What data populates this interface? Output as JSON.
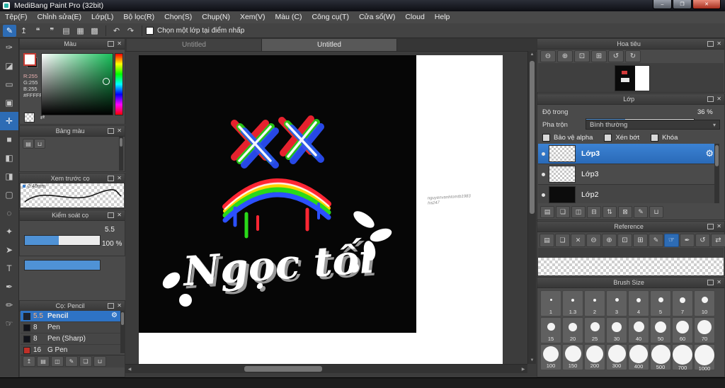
{
  "colors": {
    "accent": "#2e73c5",
    "selection_blue": "#2d6cb5",
    "close_red": "#a72f1f",
    "canvas_black": "#060606"
  },
  "icons": {
    "close": "✕",
    "gear": "⚙",
    "chevron": "▾",
    "undo": "↶",
    "redo": "↷",
    "up": "▲",
    "down": "▼",
    "left": "◀",
    "right": "▶",
    "swap": "⇄"
  },
  "window": {
    "title": "MediBang Paint Pro (32bit)",
    "min_glyph": "–",
    "max_glyph": "❐",
    "close_glyph": "✕"
  },
  "menu": {
    "items": [
      "Tệp(F)",
      "Chỉnh sửa(E)",
      "Lớp(L)",
      "Bộ lọc(R)",
      "Chọn(S)",
      "Chụp(N)",
      "Xem(V)",
      "Màu (C)",
      "Công cụ(T)",
      "Cửa sổ(W)",
      "Cloud",
      "Help"
    ]
  },
  "toolbar": {
    "snap_checkbox_label": "Chọn một lớp tại điểm nhấp",
    "icons": [
      {
        "name": "brush-mode",
        "glyph": "✎"
      },
      {
        "name": "upload",
        "glyph": "↥"
      },
      {
        "name": "comment",
        "glyph": "❝"
      },
      {
        "name": "chat",
        "glyph": "❞"
      },
      {
        "name": "page",
        "glyph": "▤"
      },
      {
        "name": "grid",
        "glyph": "▦"
      },
      {
        "name": "table",
        "glyph": "▩"
      }
    ]
  },
  "tools": [
    {
      "name": "brush",
      "glyph": "✑"
    },
    {
      "name": "eraser",
      "glyph": "◪"
    },
    {
      "name": "marquee",
      "glyph": "▭"
    },
    {
      "name": "stamp",
      "glyph": "▣"
    },
    {
      "name": "move",
      "glyph": "✛"
    },
    {
      "name": "fill",
      "glyph": "■"
    },
    {
      "name": "bucket",
      "glyph": "◧"
    },
    {
      "name": "gradient",
      "glyph": "◨"
    },
    {
      "name": "select",
      "glyph": "▢"
    },
    {
      "name": "lasso",
      "glyph": "◌"
    },
    {
      "name": "wand",
      "glyph": "✦"
    },
    {
      "name": "operation",
      "glyph": "➤"
    },
    {
      "name": "text",
      "glyph": "T"
    },
    {
      "name": "eyedropper",
      "glyph": "✒"
    },
    {
      "name": "pencil",
      "glyph": "✏"
    },
    {
      "name": "hand",
      "glyph": "☞"
    }
  ],
  "color_panel": {
    "title": "Màu",
    "r": "R:255",
    "g": "G:255",
    "b": "B:255",
    "hex": "#FFFFFF"
  },
  "palette_panel": {
    "title": "Bảng màu",
    "add_glyph": "▤",
    "trash_glyph": "⊔"
  },
  "brush_preview_panel": {
    "title": "Xem trước cọ",
    "size_label": "0.40mm"
  },
  "brush_control_panel": {
    "title": "Kiểm soát cọ",
    "size_value": "5.5",
    "opacity_value": "100 %"
  },
  "brush_list_panel": {
    "title": "Cọ: Pencil",
    "brushes": [
      {
        "size": "5.5",
        "name": "Pencil"
      },
      {
        "size": "8",
        "name": "Pen"
      },
      {
        "size": "8",
        "name": "Pen (Sharp)"
      },
      {
        "size": "16",
        "name": "G Pen"
      }
    ],
    "footer_icons": [
      {
        "name": "upload-brush",
        "glyph": "↥"
      },
      {
        "name": "add-brush",
        "glyph": "▤"
      },
      {
        "name": "duplicate-brush",
        "glyph": "◫"
      },
      {
        "name": "edit-brush",
        "glyph": "✎"
      },
      {
        "name": "brush-folder",
        "glyph": "❏"
      },
      {
        "name": "delete-brush",
        "glyph": "⊔"
      }
    ]
  },
  "canvas": {
    "tabs": [
      "Untitled",
      "Untitled"
    ],
    "artwork_text": "Ngọc tối",
    "watermark_line1": "nguyenvanhtomtb1983",
    "watermark_line2": "ha247"
  },
  "navigator_panel": {
    "title": "Hoa tiêu",
    "icons": [
      {
        "name": "zoom-out",
        "glyph": "⊖"
      },
      {
        "name": "zoom-in",
        "glyph": "⊕"
      },
      {
        "name": "fit-screen",
        "glyph": "⊡"
      },
      {
        "name": "actual-size",
        "glyph": "⊞"
      },
      {
        "name": "rotate-left",
        "glyph": "↺"
      },
      {
        "name": "rotate-right",
        "glyph": "↻"
      }
    ]
  },
  "layers_panel": {
    "title": "Lớp",
    "opacity_label": "Độ trong",
    "opacity_value": "36 %",
    "blend_label": "Pha trộn",
    "blend_value": "Bình thường",
    "checkboxes": [
      "Bảo vệ alpha",
      "Xén bớt",
      "Khóa"
    ],
    "layers": [
      {
        "name": "Lớp3"
      },
      {
        "name": "Lớp3"
      },
      {
        "name": "Lớp2"
      }
    ],
    "footer_icons": [
      {
        "name": "add-layer",
        "glyph": "▤"
      },
      {
        "name": "add-folder",
        "glyph": "❏"
      },
      {
        "name": "duplicate-layer",
        "glyph": "◫"
      },
      {
        "name": "merge-layer",
        "glyph": "⊟"
      },
      {
        "name": "transfer-layer",
        "glyph": "⇅"
      },
      {
        "name": "clear-layer",
        "glyph": "⊠"
      },
      {
        "name": "layer-settings",
        "glyph": "✎"
      },
      {
        "name": "delete-layer",
        "glyph": "⊔"
      }
    ]
  },
  "reference_panel": {
    "title": "Reference",
    "icons": [
      {
        "name": "open-image",
        "glyph": "▤"
      },
      {
        "name": "folder",
        "glyph": "❏"
      },
      {
        "name": "close-image",
        "glyph": "✕"
      },
      {
        "name": "zoom-out",
        "glyph": "⊖"
      },
      {
        "name": "zoom-in",
        "glyph": "⊕"
      },
      {
        "name": "fit-screen",
        "glyph": "⊡"
      },
      {
        "name": "actual-size",
        "glyph": "⊞"
      },
      {
        "name": "pencil",
        "glyph": "✎"
      },
      {
        "name": "hand",
        "glyph": "☞"
      },
      {
        "name": "eyedropper",
        "glyph": "✒"
      },
      {
        "name": "rotate",
        "glyph": "↺"
      },
      {
        "name": "flip",
        "glyph": "⇄"
      }
    ]
  },
  "brush_size_panel": {
    "title": "Brush Size",
    "sizes": [
      "1",
      "1.3",
      "2",
      "3",
      "4",
      "5",
      "7",
      "10",
      "15",
      "20",
      "25",
      "30",
      "40",
      "50",
      "60",
      "70",
      "100",
      "150",
      "200",
      "300",
      "400",
      "500",
      "700",
      "1000"
    ]
  }
}
